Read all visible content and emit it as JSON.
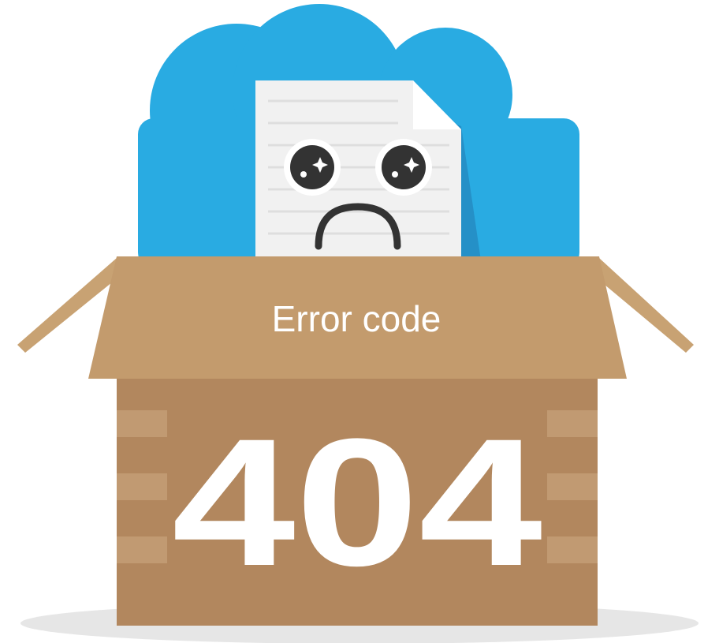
{
  "scene": {
    "box_label": "Error code",
    "error_number": "404",
    "icons": [
      "cloud-icon",
      "sad-document-icon",
      "cardboard-box-icon"
    ],
    "colors": {
      "cloud": "#29abe2",
      "cloud_shadow": "#2590c7",
      "document": "#f1f1f1",
      "document_lines": "#dedede",
      "document_fold": "#ffffff",
      "box_front": "#b2875e",
      "box_lid": "#c39b6d",
      "box_flap": "#c8a273",
      "tape": "#c19a72",
      "face": "#333333",
      "ground_shadow": "#e6e6e6",
      "text": "#ffffff"
    }
  }
}
